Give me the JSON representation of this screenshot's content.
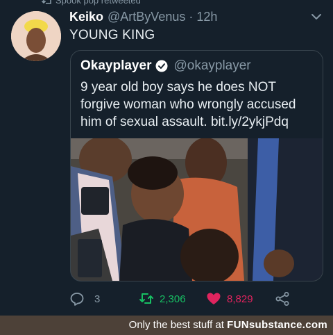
{
  "retweet_context": {
    "text": "Spook pop retweeted"
  },
  "tweet": {
    "display_name": "Keiko",
    "handle": "@ArtByVenus",
    "separator": "·",
    "time": "12h",
    "text": "YOUNG KING"
  },
  "quoted_tweet": {
    "display_name": "Okayplayer",
    "handle": "@okayplayer",
    "text": "9 year old boy says he does NOT forgive woman who wrongly accused him of sexual assault. bit.ly/2ykjPdq"
  },
  "actions": {
    "reply_count": "3",
    "retweet_count": "2,306",
    "like_count": "8,829"
  },
  "footer": {
    "prefix": "Only the best stuff at",
    "site": "FUNsubstance.com"
  },
  "colors": {
    "background": "#15202b",
    "retweet": "#17bf63",
    "like": "#e0245e",
    "muted": "#8899a6",
    "verified": "#ffffff"
  },
  "icons": [
    "retweet-icon",
    "chevron-down-icon",
    "verified-badge-icon",
    "reply-icon",
    "retweet-icon",
    "heart-icon",
    "share-icon"
  ]
}
